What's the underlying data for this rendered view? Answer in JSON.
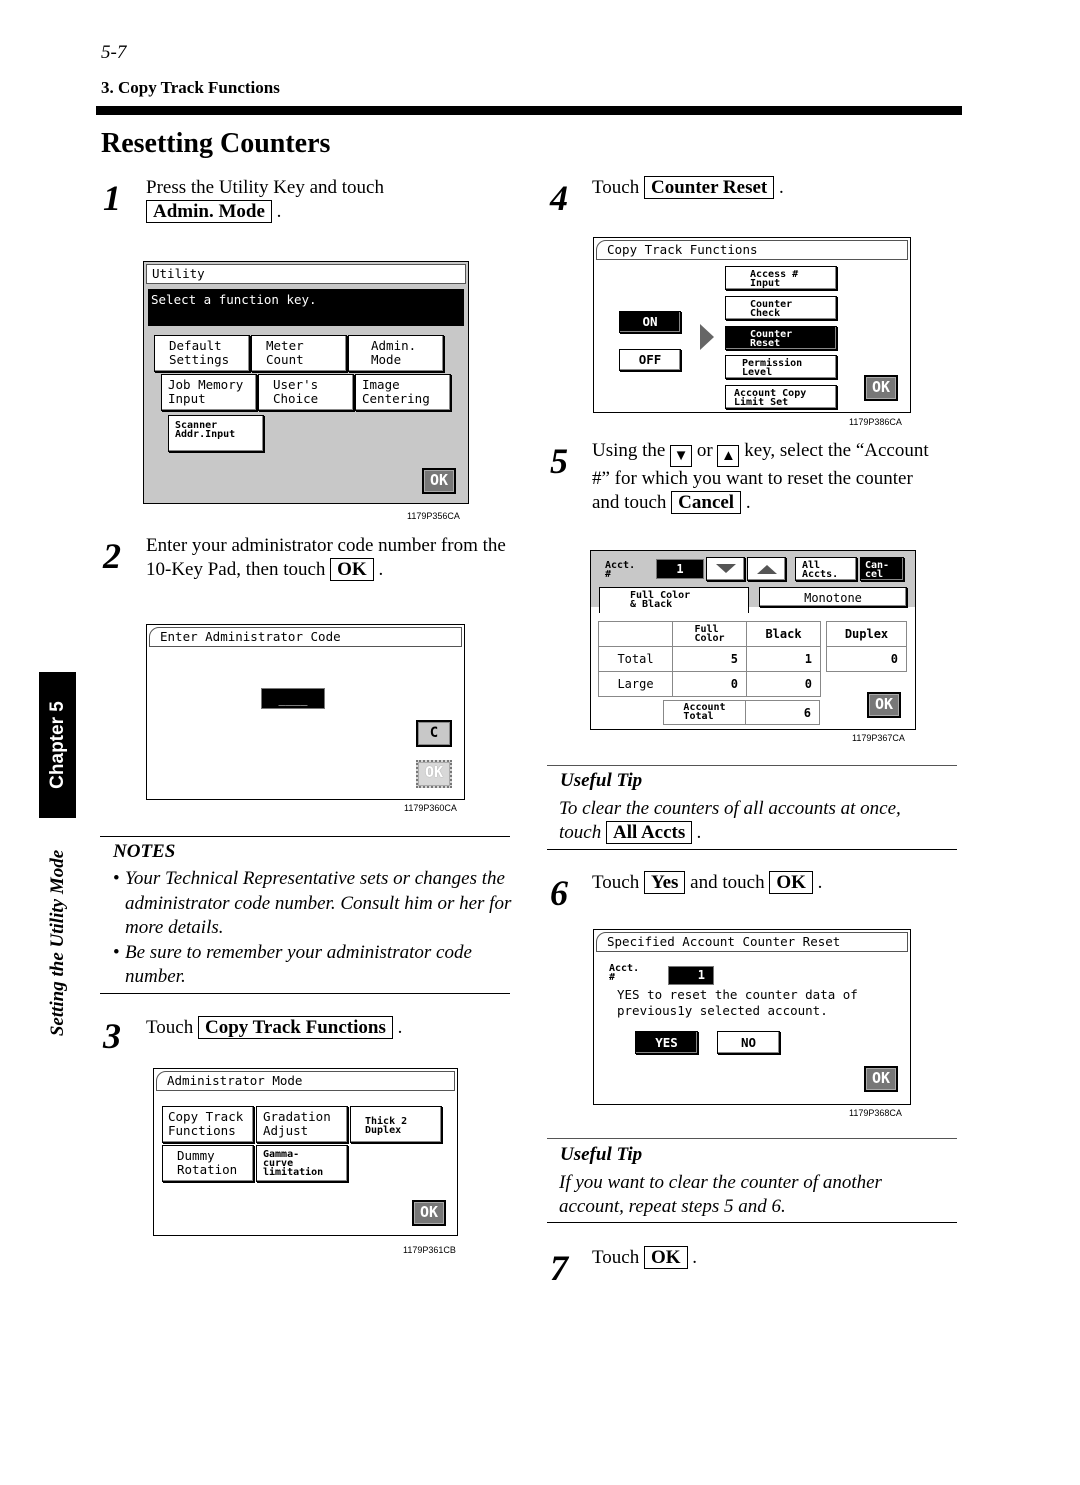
{
  "header": {
    "page_number": "5-7",
    "section": "3. Copy Track Functions",
    "title": "Resetting Counters"
  },
  "side": {
    "chapter_tab": "Chapter 5",
    "caption": "Setting the Utility Mode"
  },
  "steps": [
    {
      "num": "1",
      "text_before": "Press the Utility Key and touch",
      "key": "Admin. Mode",
      "text_after": "."
    },
    {
      "num": "2",
      "text_before": "Enter your administrator code number from the 10-Key Pad, then touch",
      "key": "OK",
      "text_after": "."
    },
    {
      "num": "3",
      "text_before": "Touch",
      "key": "Copy Track Functions",
      "text_after": "."
    },
    {
      "num": "4",
      "text_before": "Touch",
      "key": "Counter Reset",
      "text_after": "."
    },
    {
      "num": "5",
      "text_1": "Using the",
      "down_key": "▼",
      "text_2": "or",
      "up_key": "▲",
      "text_3": "key, select the “Account",
      "text_4": "#” for which you want to reset the counter",
      "text_5": "and touch",
      "key": "Cancel",
      "text_after": "."
    },
    {
      "num": "6",
      "text_before": "Touch",
      "key": "Yes",
      "text_mid": "and touch",
      "key2": "OK",
      "text_after": "."
    },
    {
      "num": "7",
      "text_before": "Touch",
      "key": "OK",
      "text_after": "."
    }
  ],
  "notes": {
    "heading": "NOTES",
    "items": [
      "Your Technical Representative sets or changes the administrator code number. Consult him or her for more details.",
      "Be sure to remember your administrator code number."
    ]
  },
  "tips": [
    {
      "heading": "Useful Tip",
      "text": "To clear the counters of all accounts at once,",
      "text2": "touch",
      "key": "All Accts",
      "text_after": "."
    },
    {
      "heading": "Useful Tip",
      "text": "If you want to clear the counter of another",
      "text2": "account, repeat steps 5 and 6."
    }
  ],
  "screens": {
    "utility": {
      "title": "Utility",
      "message": "Select a function key.",
      "buttons": [
        "Default\nSettings",
        "Meter\nCount",
        "Admin.\nMode",
        "Job Memory\nInput",
        "User's\nChoice",
        "Image\nCentering",
        "Scanner\nAddr.Input"
      ],
      "ok": "OK",
      "fig_id": "1179P356CA"
    },
    "admin_code": {
      "title": "Enter Administrator Code",
      "code_value": "____",
      "clear": "C",
      "ok": "OK",
      "fig_id": "1179P360CA"
    },
    "admin_mode": {
      "title": "Administrator Mode",
      "buttons": [
        "Copy Track\nFunctions",
        "Gradation\nAdjust",
        "Thick 2\nDuplex",
        "Dummy\nRotation",
        "Gamma-\ncurve\nlimitation"
      ],
      "ok": "OK",
      "fig_id": "1179P361CB"
    },
    "copy_track": {
      "title": "Copy Track Functions",
      "on": "ON",
      "off": "OFF",
      "buttons": [
        "Access #\nInput",
        "Counter\nCheck",
        "Counter\nReset",
        "Permission\nLevel",
        "Account Copy\nLimit Set"
      ],
      "selected": "Counter\nReset",
      "ok": "OK",
      "fig_id": "1179P386CA"
    },
    "counter": {
      "acct_label": "Acct.\n#",
      "acct_value": "1",
      "all_accts": "All\nAccts.",
      "cancel": "Can-\ncel",
      "tabs": [
        "Full Color\n& Black",
        "Monotone"
      ],
      "columns": [
        "",
        "Full\nColor",
        "Black",
        "Duplex"
      ],
      "rows": [
        {
          "label": "Total",
          "full_color": "5",
          "black": "1",
          "duplex": "0"
        },
        {
          "label": "Large",
          "full_color": "0",
          "black": "0"
        }
      ],
      "account_total_label": "Account\nTotal",
      "account_total": "6",
      "ok": "OK",
      "fig_id": "1179P367CA"
    },
    "reset_confirm": {
      "title": "Specified Account Counter Reset",
      "acct_label": "Acct.\n#",
      "acct_value": "1",
      "message": "YES to reset the counter data of\nprevious1y selected account.",
      "yes": "YES",
      "no": "NO",
      "ok": "OK",
      "fig_id": "1179P368CA"
    }
  }
}
